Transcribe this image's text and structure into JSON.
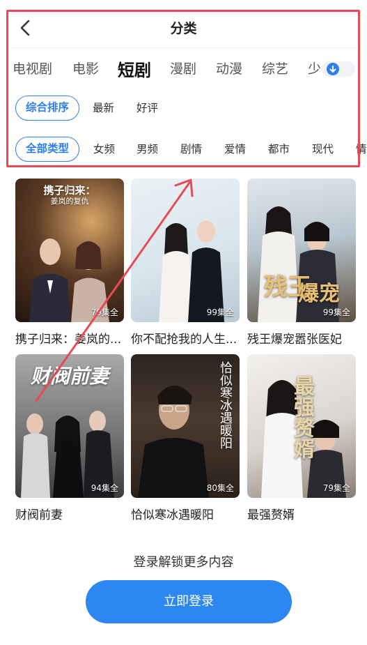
{
  "header": {
    "title": "分类"
  },
  "categories": [
    "电视剧",
    "电影",
    "短剧",
    "漫剧",
    "动漫",
    "综艺",
    "少"
  ],
  "active_category": "短剧",
  "sort_filters": [
    "综合排序",
    "最新",
    "好评"
  ],
  "type_filters": [
    "全部类型",
    "女频",
    "男频",
    "剧情",
    "爱情",
    "都市",
    "现代",
    "情"
  ],
  "poster_texts": {
    "p1_line1": "携子归来：",
    "p1_line2": "姜岚的复仇",
    "p3_a": "残王",
    "p3_b": "爆宠",
    "p4": "财阀前妻",
    "p5": "恰似寒冰遇暖阳",
    "p6": "最强赘婿"
  },
  "dramas": [
    {
      "name": "携子归来：姜岚的...",
      "episodes": "79集全"
    },
    {
      "name": "你不配抢我的人生...",
      "episodes": "99集全"
    },
    {
      "name": "残王爆宠嚣张医妃",
      "episodes": "99集全"
    },
    {
      "name": "财阀前妻",
      "episodes": "94集全"
    },
    {
      "name": "恰似寒冰遇暖阳",
      "episodes": "80集全"
    },
    {
      "name": "最强赘婿",
      "episodes": "79集全"
    }
  ],
  "login": {
    "tip": "登录解锁更多内容",
    "button": "立即登录"
  },
  "colors": {
    "accent": "#2d7ef0",
    "annotation": "#e84a55"
  }
}
